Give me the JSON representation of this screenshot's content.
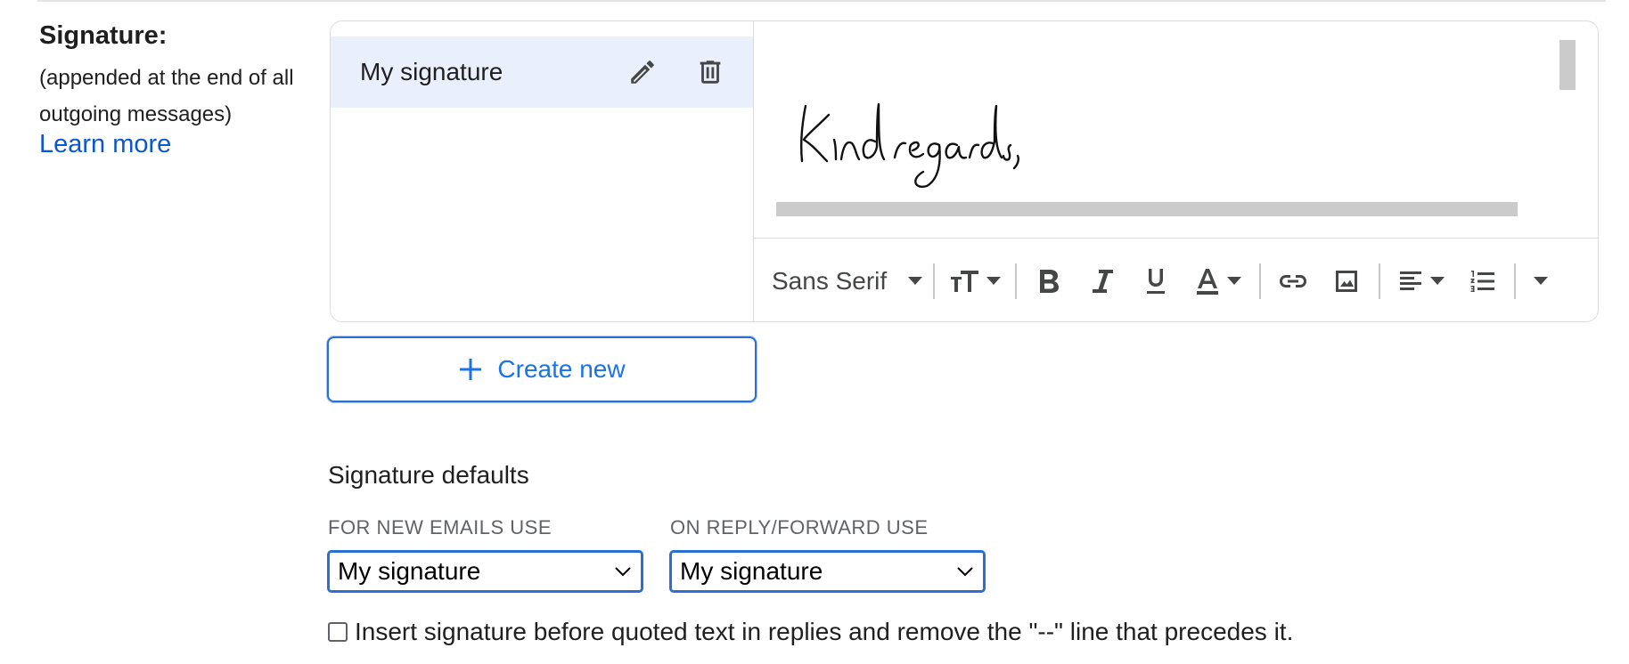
{
  "signature_section": {
    "label": "Signature:",
    "description": "(appended at the end of all outgoing messages)",
    "learn_more": "Learn more"
  },
  "signature_list": {
    "items": [
      {
        "name": "My signature"
      }
    ]
  },
  "editor": {
    "font_family": "Sans Serif",
    "signature_image_alt": "Kind regards,",
    "toolbar": [
      "font-family-select",
      "font-size-icon",
      "bold-icon",
      "italic-icon",
      "underline-icon",
      "text-color-icon",
      "link-icon",
      "image-icon",
      "align-icon",
      "numbered-list-icon",
      "more-formatting-icon"
    ]
  },
  "create_new": {
    "label": "Create new"
  },
  "defaults": {
    "title": "Signature defaults",
    "new_emails_label": "FOR NEW EMAILS USE",
    "new_emails_value": "My signature",
    "reply_forward_label": "ON REPLY/FORWARD USE",
    "reply_forward_value": "My signature"
  },
  "insert_before_quoted": {
    "label": "Insert signature before quoted text in replies and remove the \"--\" line that precedes it.",
    "checked": false
  },
  "colors": {
    "link": "#0b57d0",
    "accent": "#1a73e8",
    "selected_item_bg": "#e9f0fc"
  }
}
